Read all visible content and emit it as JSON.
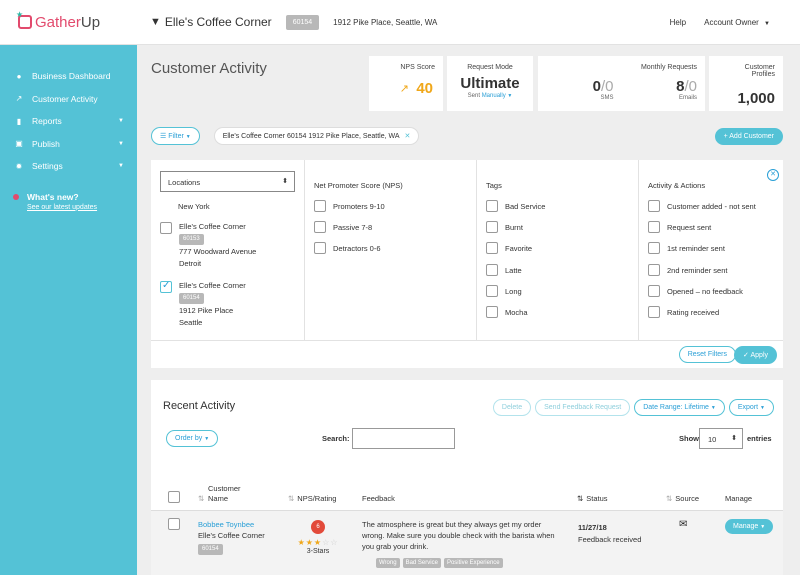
{
  "topbar": {
    "logo_gather": "Gather",
    "logo_up": "Up",
    "location_name": "Elle's Coffee Corner",
    "location_id": "60154",
    "location_address": "1912 Pike Place, Seattle, WA",
    "help": "Help",
    "account": "Account Owner"
  },
  "sidebar": {
    "items": [
      {
        "label": "Business Dashboard",
        "icon": "location-pin-icon"
      },
      {
        "label": "Customer Activity",
        "icon": "trend-line-icon"
      },
      {
        "label": "Reports",
        "icon": "bar-chart-icon"
      },
      {
        "label": "Publish",
        "icon": "calendar-icon"
      },
      {
        "label": "Settings",
        "icon": "gear-icon"
      }
    ],
    "whats_new": "What's new?",
    "whats_new_link": "See our latest updates"
  },
  "main": {
    "title": "Customer Activity",
    "stats": {
      "nps_label": "NPS Score",
      "nps_value": "40",
      "mode_label": "Request Mode",
      "mode_value": "Ultimate",
      "mode_sub_prefix": "Sent",
      "mode_sub_value": "Manually",
      "monthly_label": "Monthly Requests",
      "sms_used": "0",
      "sms_total": "0",
      "sms_label": "SMS",
      "emails_used": "8",
      "emails_total": "0",
      "emails_label": "Emails",
      "profiles_label_1": "Customer",
      "profiles_label_2": "Profiles",
      "profiles_value": "1,000"
    },
    "filter_button": "Filter",
    "filter_chip": "Elle's Coffee Corner 60154 1912 Pike Place, Seattle, WA",
    "add_customer": "+ Add Customer"
  },
  "filters": {
    "locations_label": "Locations",
    "locations": [
      {
        "name": "New York"
      },
      {
        "name": "Elle's Coffee Corner",
        "id": "60153",
        "address": "777 Woodward Avenue",
        "city": "Detroit",
        "checked": false
      },
      {
        "name": "Elle's Coffee Corner",
        "id": "60154",
        "address": "1912 Pike Place",
        "city": "Seattle",
        "checked": true
      }
    ],
    "nps_title": "Net Promoter Score (NPS)",
    "nps_options": [
      "Promoters 9-10",
      "Passive 7-8",
      "Detractors 0-6"
    ],
    "tags_title": "Tags",
    "tags_options": [
      "Bad Service",
      "Burnt",
      "Favorite",
      "Latte",
      "Long",
      "Mocha"
    ],
    "activity_title": "Activity & Actions",
    "activity_options": [
      "Customer added - not sent",
      "Request sent",
      "1st reminder sent",
      "2nd reminder sent",
      "Opened – no feedback",
      "Rating received"
    ],
    "reset": "Reset Filters",
    "apply": "Apply"
  },
  "recent": {
    "title": "Recent Activity",
    "delete": "Delete",
    "send_feedback": "Send Feedback Request",
    "date_range": "Date Range: Lifetime",
    "export": "Export",
    "order_by": "Order by",
    "search_label": "Search:",
    "show_label": "Show",
    "show_value": "10",
    "entries_label": "entries",
    "columns": {
      "customer_1": "Customer",
      "customer_2": "Name",
      "nps": "NPS/Rating",
      "feedback": "Feedback",
      "status": "Status",
      "source": "Source",
      "manage": "Manage"
    },
    "rows": [
      {
        "name": "Bobbee Toynbee",
        "location": "Elle's Coffee Corner",
        "location_id": "60154",
        "nps": "6",
        "rating": 3,
        "rating_label": "3-Stars",
        "feedback": "The atmosphere is great but they always get my order wrong. Make sure you double check with the barista when you grab your drink.",
        "tags": [
          "Wrong",
          "Bad Service",
          "Positive Experience"
        ],
        "date": "11/27/18",
        "status": "Feedback received",
        "source_icon": "envelope-icon",
        "manage": "Manage"
      }
    ]
  },
  "colors": {
    "sidebar": "#54c2d6",
    "accent": "#2a9fd6",
    "nps": "#f0a719",
    "brand": "#e24a6d",
    "detractor": "#e24a3a"
  }
}
